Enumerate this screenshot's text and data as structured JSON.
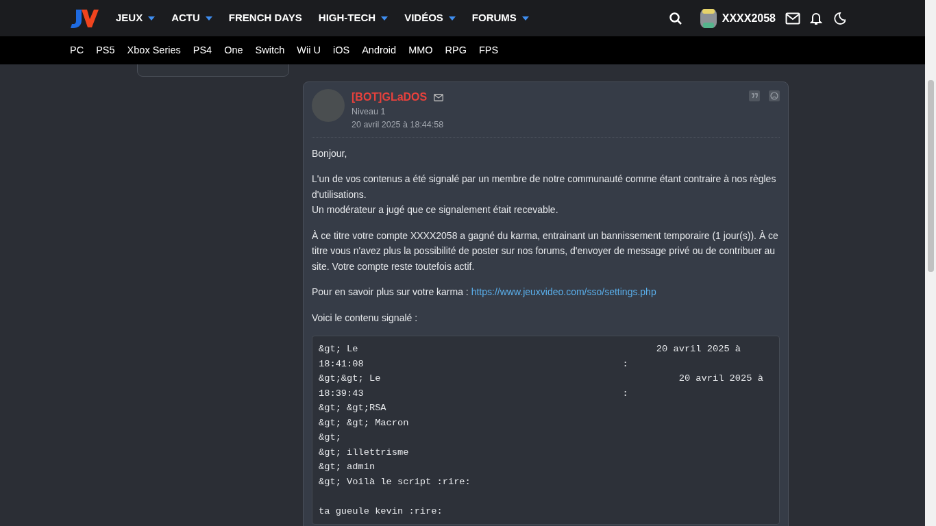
{
  "header": {
    "nav": [
      {
        "label": "JEUX",
        "dropdown": true
      },
      {
        "label": "ACTU",
        "dropdown": true
      },
      {
        "label": "FRENCH DAYS",
        "dropdown": false
      },
      {
        "label": "HIGH-TECH",
        "dropdown": true
      },
      {
        "label": "VIDÉOS",
        "dropdown": true
      },
      {
        "label": "FORUMS",
        "dropdown": true
      }
    ],
    "username": "XXXX2058"
  },
  "platforms": [
    "PC",
    "PS5",
    "Xbox Series",
    "PS4",
    "One",
    "Switch",
    "Wii U",
    "iOS",
    "Android",
    "MMO",
    "RPG",
    "FPS"
  ],
  "message": {
    "author": "[BOT]GLaDOS",
    "level": "Niveau 1",
    "date": "20 avril 2025 à 18:44:58",
    "paragraphs": [
      {
        "kind": "text",
        "lines": [
          "Bonjour,"
        ]
      },
      {
        "kind": "text",
        "lines": [
          "L'un de vos contenus a été signalé par un membre de notre communauté comme étant contraire à nos règles d'utilisations.",
          "Un modérateur a jugé que ce signalement était recevable."
        ]
      },
      {
        "kind": "text",
        "lines": [
          "À ce titre votre compte XXXX2058 a gagné du karma, entrainant un bannissement temporaire (1 jour(s)). À ce titre vous n'avez plus la possibilité de poster sur nos forums, d'envoyer de message privé ou de contribuer au site. Votre compte reste toutefois actif."
        ]
      },
      {
        "kind": "link",
        "text": "Pour en savoir plus sur votre karma :",
        "url": "https://www.jeuxvideo.com/sso/settings.php"
      },
      {
        "kind": "text",
        "lines": [
          "Voici le contenu signalé :"
        ]
      }
    ],
    "quote_blocks": [
      [
        "&gt; Le                                                     20 avril 2025 à",
        "18:41:08                                              :",
        "&gt;&gt; Le                                                     20 avril 2025 à",
        "18:39:43                                              :",
        "&gt; &gt;RSA",
        "&gt; &gt; Macron",
        "&gt;",
        "&gt; illettrisme",
        "&gt; admin",
        "&gt; Voilà le script :rire:"
      ],
      [
        "ta gueule kevin :rire:"
      ]
    ]
  }
}
